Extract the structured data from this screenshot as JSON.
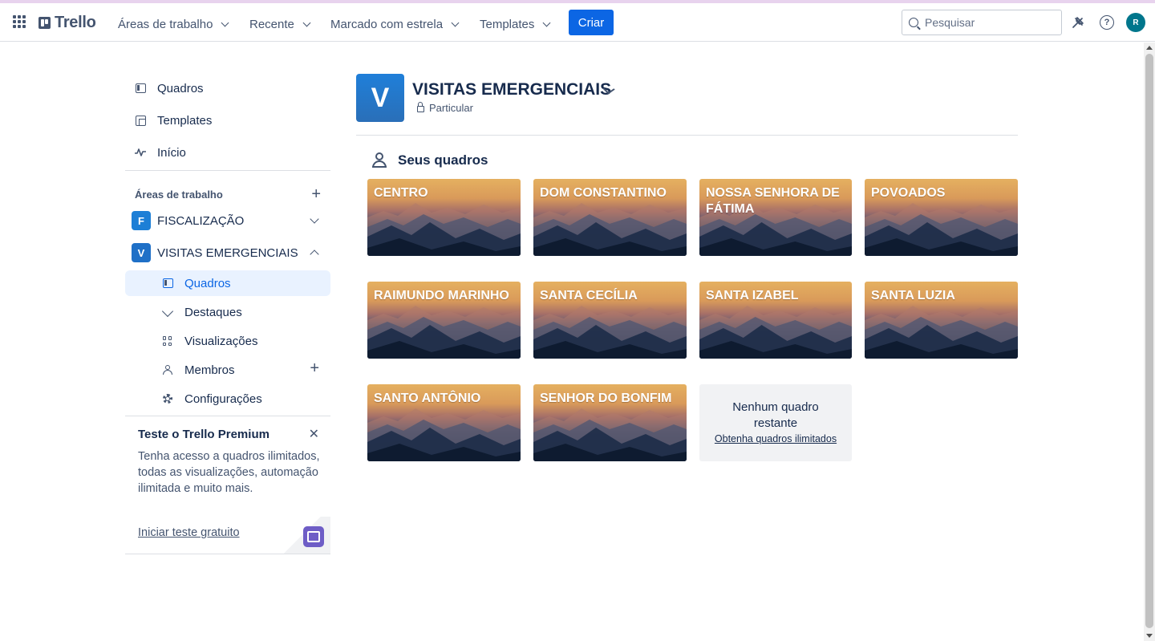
{
  "app": {
    "logo_text": "Trello"
  },
  "topbar": {
    "nav": [
      {
        "label": "Áreas de trabalho"
      },
      {
        "label": "Recente"
      },
      {
        "label": "Marcado com estrela"
      },
      {
        "label": "Templates"
      }
    ],
    "create_label": "Criar",
    "search_placeholder": "Pesquisar",
    "avatar_initial": "R"
  },
  "sidebar": {
    "links": [
      {
        "label": "Quadros",
        "icon": "board-icon"
      },
      {
        "label": "Templates",
        "icon": "templates-icon"
      },
      {
        "label": "Início",
        "icon": "activity-icon"
      }
    ],
    "workspaces_heading": "Áreas de trabalho",
    "workspaces": [
      {
        "badge": "F",
        "name": "FISCALIZAÇÃO",
        "color": "#1d7fd6",
        "expanded": false
      },
      {
        "badge": "V",
        "name": "VISITAS EMERGENCIAIS",
        "color": "#1f70c7",
        "expanded": true
      }
    ],
    "sub_links": [
      {
        "label": "Quadros",
        "icon": "board-icon",
        "active": true
      },
      {
        "label": "Destaques",
        "icon": "heart-icon"
      },
      {
        "label": "Visualizações",
        "icon": "grid-icon"
      },
      {
        "label": "Membros",
        "icon": "members-icon"
      },
      {
        "label": "Configurações",
        "icon": "gear-icon"
      }
    ],
    "premium": {
      "title": "Teste o Trello Premium",
      "text": "Tenha acesso a quadros ilimitados, todas as visualizações, automação ilimitada e muito mais.",
      "cta": "Iniciar teste gratuito"
    }
  },
  "workspace": {
    "logo_letter": "V",
    "title": "VISITAS EMERGENCIAIS",
    "privacy": "Particular"
  },
  "boards_section": {
    "title": "Seus quadros",
    "boards": [
      {
        "title": "CENTRO"
      },
      {
        "title": "DOM CONSTANTINO"
      },
      {
        "title": "NOSSA SENHORA DE FÁTIMA"
      },
      {
        "title": "POVOADOS"
      },
      {
        "title": "RAIMUNDO MARINHO"
      },
      {
        "title": "SANTA CECÍLIA"
      },
      {
        "title": "SANTA IZABEL"
      },
      {
        "title": "SANTA LUZIA"
      },
      {
        "title": "SANTO ANTÔNIO"
      },
      {
        "title": "SENHOR DO BONFIM"
      }
    ],
    "no_boards_text": "Nenhum quadro restante",
    "no_boards_link": "Obtenha quadros ilimitados"
  },
  "colors": {
    "accent": "#0c66e4",
    "text": "#172b4d",
    "muted": "#44546f",
    "active_bg": "#e9f2ff",
    "premium_icon": "#6e5dc6"
  }
}
